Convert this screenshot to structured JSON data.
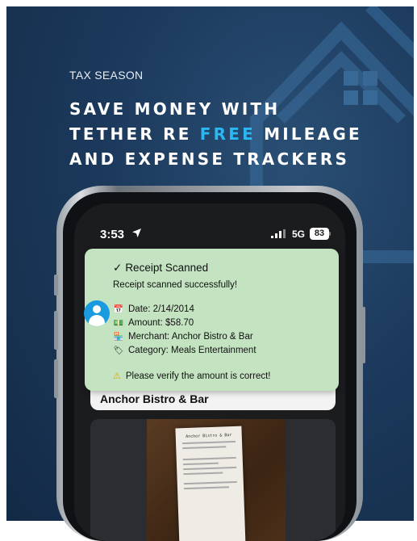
{
  "ad": {
    "eyebrow": "TAX SEASON",
    "headline_part1": "SAVE MONEY WITH",
    "headline_part2a": "TETHER RE ",
    "headline_accent": "FREE",
    "headline_part2b": " MILEAGE",
    "headline_part3": "AND EXPENSE TRACKERS",
    "accent_color": "#2bb8f2",
    "background_color": "#1c3a5d"
  },
  "status_bar": {
    "time": "3:53",
    "location_icon": "location-arrow-icon",
    "network": "5G",
    "battery": "83"
  },
  "background_card": {
    "title": "Anchor Bistro & Bar"
  },
  "receipt_image": {
    "header": "Anchor Bistro & Bar"
  },
  "toast": {
    "title": "Receipt Scanned",
    "check": "✓",
    "message": "Receipt scanned successfully!",
    "details": [
      {
        "icon": "calendar-icon",
        "glyph": "📅",
        "text": "Date: 2/14/2014"
      },
      {
        "icon": "money-icon",
        "glyph": "💵",
        "text": "Amount: $58.70"
      },
      {
        "icon": "store-icon",
        "glyph": "🏪",
        "text": "Merchant: Anchor Bistro & Bar"
      },
      {
        "icon": "tag-icon",
        "glyph": "🏷",
        "text": "Category: Meals Entertainment"
      }
    ],
    "warning": "Please verify the amount is correct!",
    "background_color": "#c3e3c1"
  }
}
